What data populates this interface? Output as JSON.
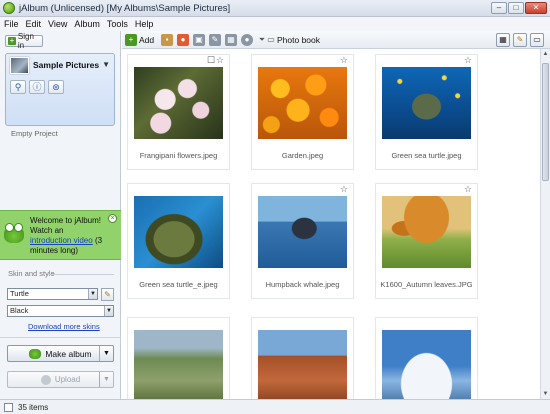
{
  "window": {
    "title": "jAlbum (Unlicensed) [My Albums\\Sample Pictures]",
    "minimize": "–",
    "maximize": "□",
    "close": "✕"
  },
  "menu": [
    "File",
    "Edit",
    "View",
    "Album",
    "Tools",
    "Help"
  ],
  "left": {
    "sign_in": "Sign in",
    "project_title": "Sample Pictures",
    "empty_project": "Empty Project",
    "welcome": {
      "line1": "Welcome to jAlbum!",
      "line2": "Watch an",
      "link": "introduction video",
      "line3": " (3 minutes long)"
    },
    "skin_and_style": "Skin and style",
    "skin": "Turtle",
    "style": "Black",
    "download_skins": "Download more skins",
    "make_album": "Make album",
    "upload": "Upload"
  },
  "toolbar": {
    "add": "Add",
    "photo_book": "Photo book"
  },
  "thumbnails": [
    {
      "caption": "Frangipani flowers.jpeg",
      "badges": "☐☆"
    },
    {
      "caption": "Garden.jpeg",
      "badges": "☆"
    },
    {
      "caption": "Green sea turtle.jpeg",
      "badges": "☆"
    },
    {
      "caption": "Green sea turtle_e.jpeg",
      "badges": ""
    },
    {
      "caption": "Humpback whale.jpeg",
      "badges": "☆"
    },
    {
      "caption": "K1600_Autumn leaves.JPG",
      "badges": "☆"
    },
    {
      "caption": "",
      "badges": ""
    },
    {
      "caption": "",
      "badges": ""
    },
    {
      "caption": "",
      "badges": ""
    }
  ],
  "status": {
    "count": "35 items"
  }
}
